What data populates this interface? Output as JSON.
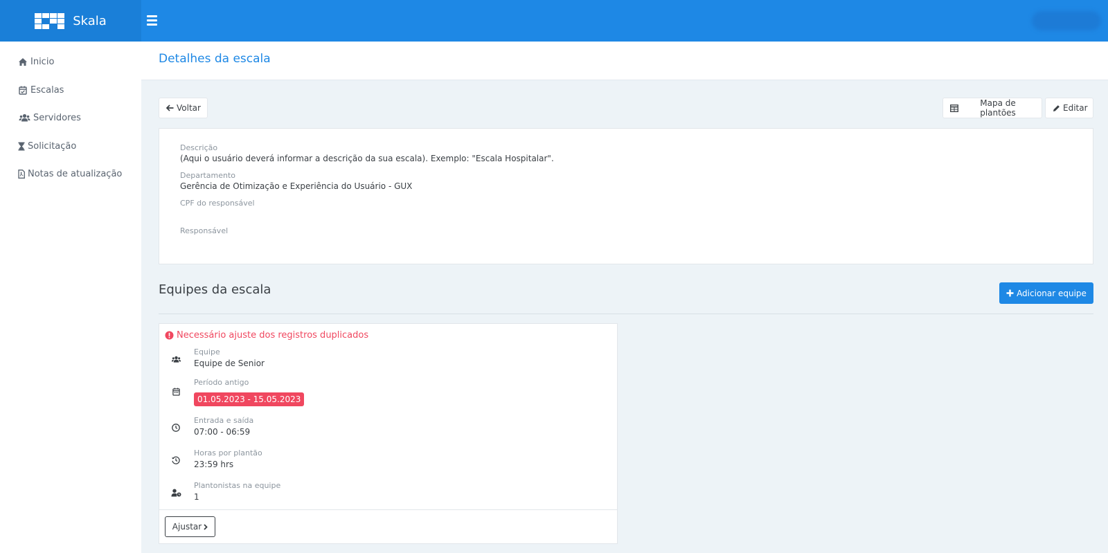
{
  "app": {
    "name": "Skala"
  },
  "sidebar": {
    "items": [
      {
        "label": "Inicio",
        "icon": "home-icon"
      },
      {
        "label": "Escalas",
        "icon": "calendar-check-icon"
      },
      {
        "label": "Servidores",
        "icon": "users-icon"
      },
      {
        "label": "Solicitação",
        "icon": "hourglass-icon"
      },
      {
        "label": "Notas de atualização",
        "icon": "file-pdf-icon"
      }
    ]
  },
  "page": {
    "title": "Detalhes da escala"
  },
  "toolbar": {
    "back_label": "Voltar",
    "map_label": "Mapa de plantões",
    "edit_label": "Editar"
  },
  "details": {
    "descricao_label": "Descrição",
    "descricao_value": "(Aqui o usuário deverá informar a descrição da sua escala). Exemplo: \"Escala Hospitalar\".",
    "departamento_label": "Departamento",
    "departamento_value": "Gerência de Otimização e Experiência do Usuário - GUX",
    "cpf_label": "CPF do responsável",
    "responsavel_label": "Responsável"
  },
  "teams": {
    "title": "Equipes da escala",
    "add_label": "Adicionar equipe",
    "card": {
      "warning": "Necessário ajuste dos registros duplicados",
      "equipe_label": "Equipe",
      "equipe_value": "Equipe de Senior",
      "periodo_label": "Período antigo",
      "periodo_value": "01.05.2023 - 15.05.2023",
      "entrada_label": "Entrada e saída",
      "entrada_value": "07:00 - 06:59",
      "horas_label": "Horas por plantão",
      "horas_value": "23:59 hrs",
      "plantonistas_label": "Plantonistas na equipe",
      "plantonistas_value": "1",
      "adjust_label": "Ajustar"
    }
  },
  "colors": {
    "primary": "#1e88e5",
    "danger": "#f0475f",
    "background": "#edf3f7"
  }
}
